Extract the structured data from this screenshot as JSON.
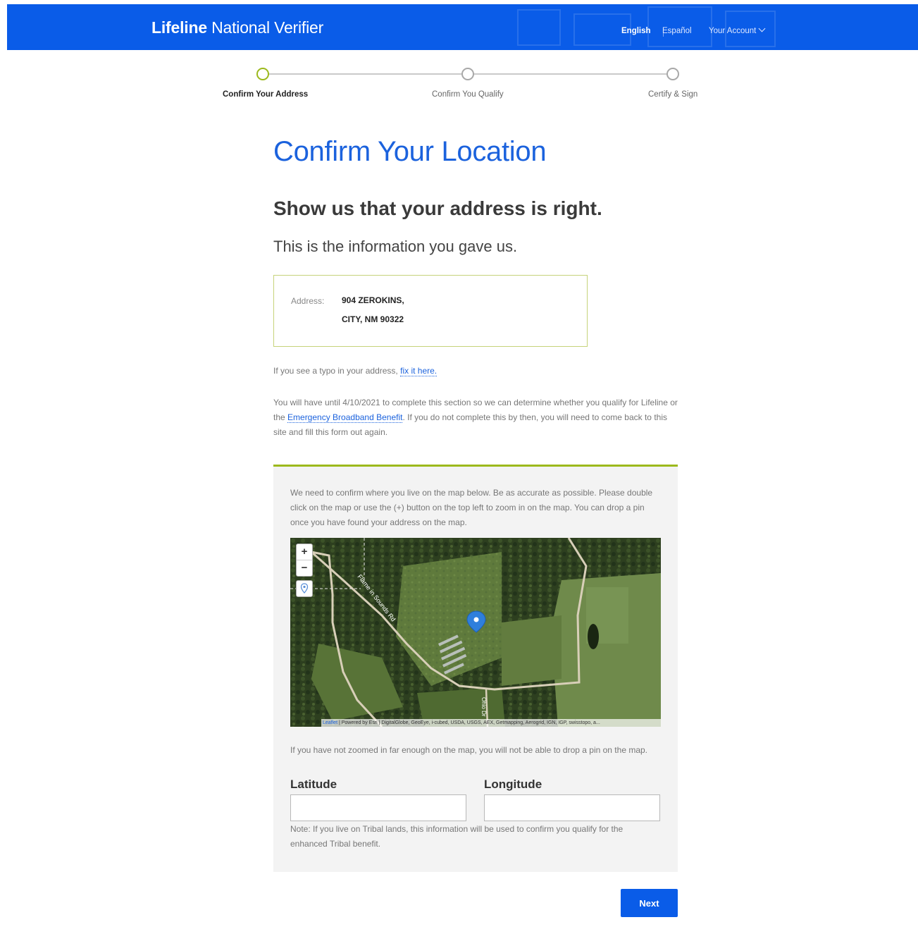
{
  "header": {
    "brand_bold": "Lifeline",
    "brand_rest": " National Verifier",
    "nav": {
      "english": "English",
      "espanol": "Español",
      "account": "Your Account"
    }
  },
  "stepper": {
    "steps": [
      {
        "label": "Confirm Your Address",
        "active": true
      },
      {
        "label": "Confirm You Qualify",
        "active": false
      },
      {
        "label": "Certify & Sign",
        "active": false
      }
    ]
  },
  "page": {
    "title": "Confirm Your Location",
    "subtitle": "Show us that your address is right.",
    "lead": "This is the information you gave us."
  },
  "address": {
    "label": "Address:",
    "line1": "904 ZEROKINS,",
    "line2": "CITY, NM 90322"
  },
  "typo": {
    "text": "If you see a typo in your address, ",
    "link": "fix it here."
  },
  "deadline": {
    "part1": "You will have until 4/10/2021 to complete this section so we can determine whether you qualify for Lifeline or the ",
    "link": "Emergency Broadband Benefit",
    "part2": ". If you do not complete this by then, you will need to come back to this site and fill this form out again."
  },
  "map_panel": {
    "instructions": "We need to confirm where you live on the map below. Be as accurate as possible. Please double click on the map or use the (+) button on the top left to zoom in on the map. You can drop a pin once you have found your address on the map.",
    "zoom_in": "+",
    "zoom_out": "−",
    "attribution_link": "Leaflet",
    "attribution_text": " | Powered by Esri | DigitalGlobe, GeoEye, i-cubed, USDA, USGS, AEX, Getmapping, Aerogrid, IGN, IGP, swisstopo, a...",
    "road_label_1": "Flame in Sounds Rd",
    "road_label_2": "Ohio Dr",
    "zoom_note": "If you have not zoomed in far enough on the map, you will not be able to drop a pin on the map.",
    "latitude_label": "Latitude",
    "longitude_label": "Longitude",
    "latitude_value": "",
    "longitude_value": "",
    "tribal_note": "Note: If you live on Tribal lands, this information will be used to confirm you qualify for the enhanced Tribal benefit."
  },
  "actions": {
    "next": "Next"
  },
  "colors": {
    "brand_blue": "#0a5ce8",
    "accent_green": "#9cb91c",
    "title_blue": "#1b62dd"
  }
}
